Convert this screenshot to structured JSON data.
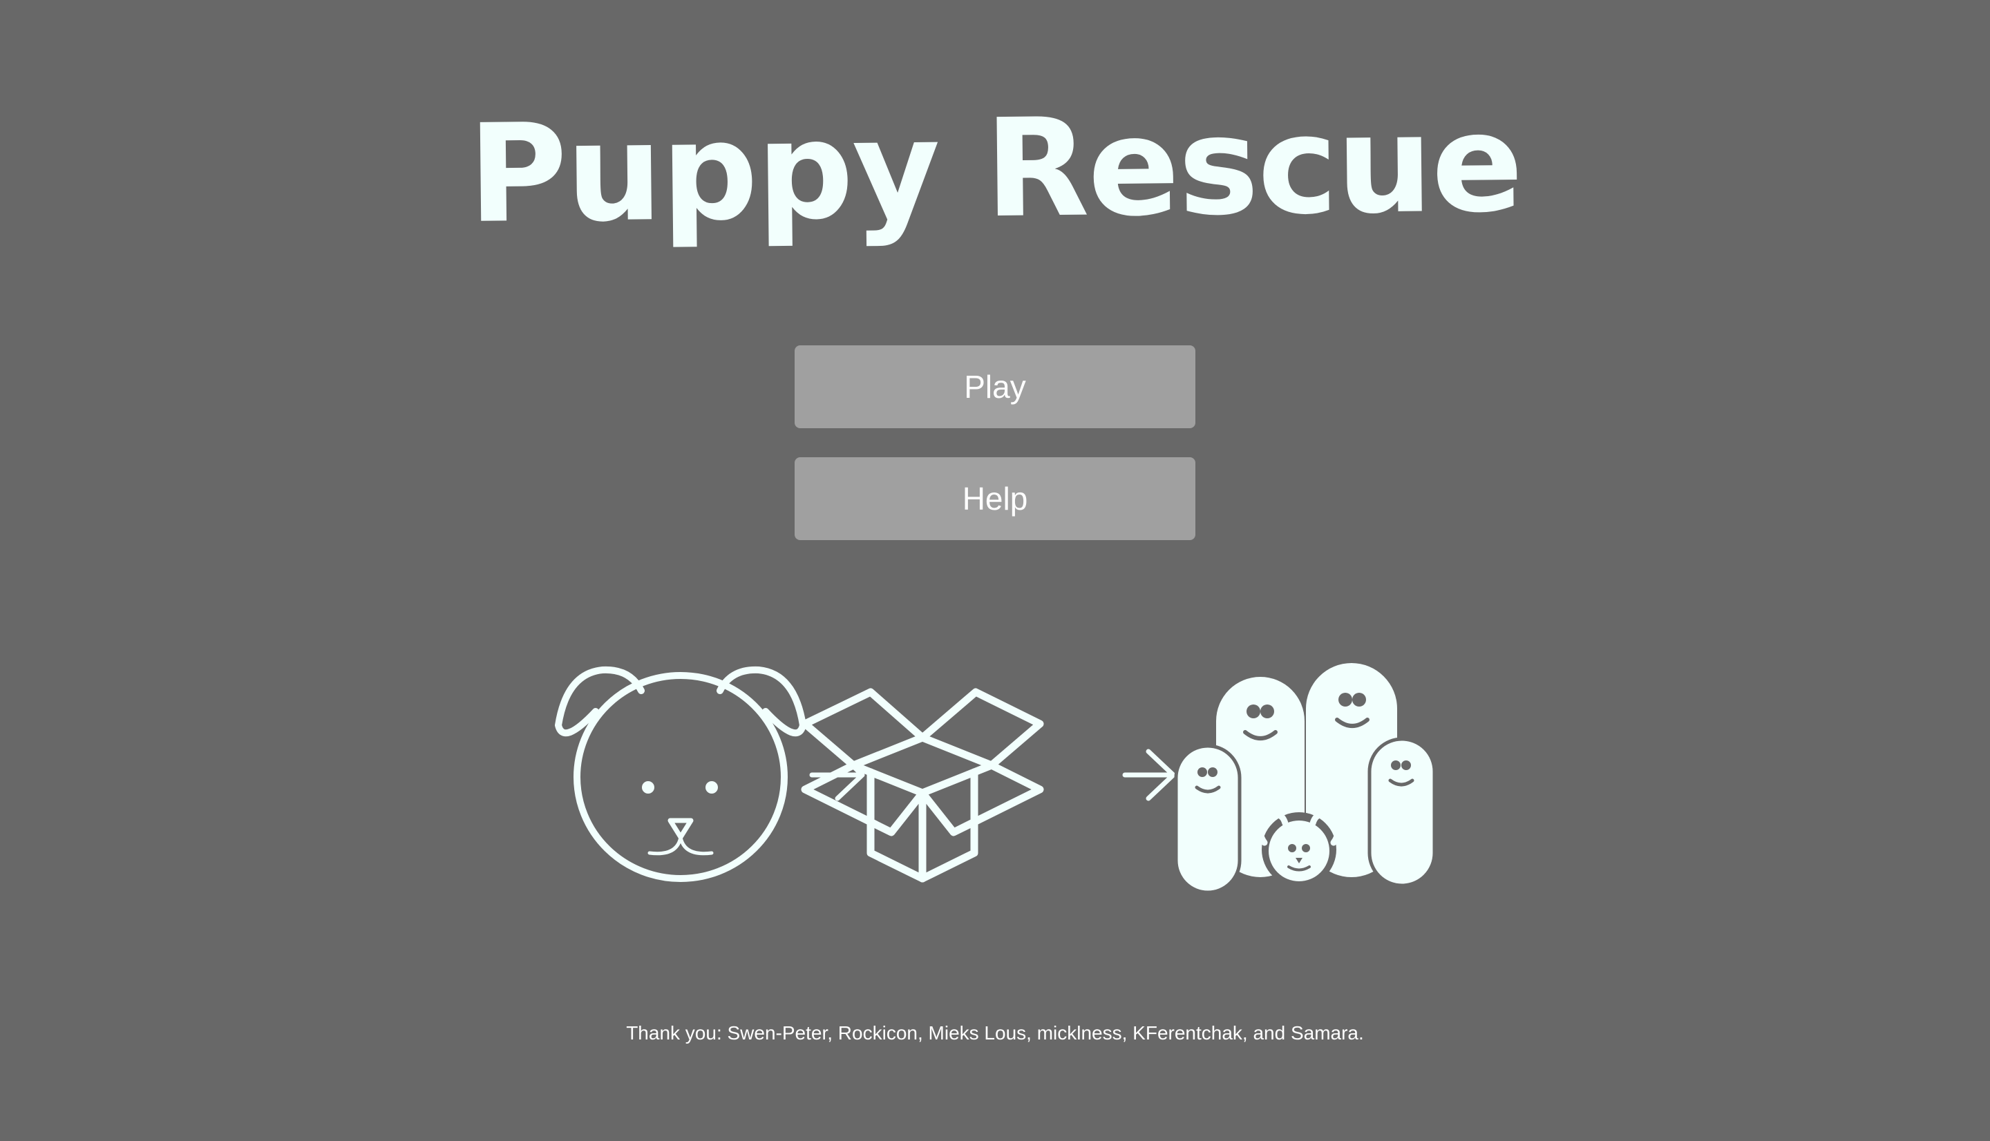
{
  "title": "Puppy Rescue",
  "menu": {
    "play_label": "Play",
    "help_label": "Help"
  },
  "illustration": {
    "icons": [
      "puppy-face-icon",
      "arrow-right-icon",
      "open-box-icon",
      "arrow-right-icon",
      "family-with-puppy-icon"
    ]
  },
  "credits": "Thank you: Swen-Peter, Rockicon, Mieks Lous, micklness, KFerentchak, and Samara.",
  "colors": {
    "background": "#686868",
    "foreground": "#f2fffd",
    "button": "#a0a0a0"
  }
}
